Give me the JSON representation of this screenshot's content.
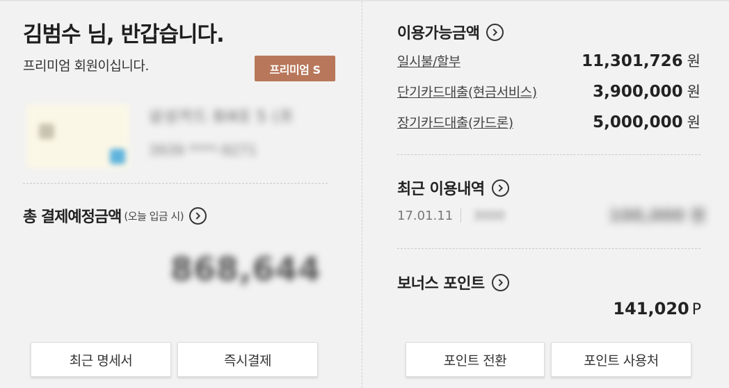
{
  "greeting": "김범수 님, 반갑습니다.",
  "member_text": "프리미엄 회원이십니다.",
  "grade_badge": "프리미엄 S",
  "card": {
    "name_blurred": "삼성카드 BIKE 5 (프",
    "number_blurred": "3939 ****-9271"
  },
  "total_payment": {
    "title": "총 결제예정금액",
    "subtitle": "(오늘 입금 시)",
    "amount_blurred": "868,644"
  },
  "left_buttons": {
    "recent_statement": "최근 명세서",
    "instant_payment": "즉시결제"
  },
  "available_limit": {
    "title": "이용가능금액",
    "rows": [
      {
        "label": "일시불/할부",
        "value": "11,301,726",
        "unit": "원"
      },
      {
        "label": "단기카드대출(현금서비스)",
        "value": "3,900,000",
        "unit": "원"
      },
      {
        "label": "장기카드대출(카드론)",
        "value": "5,000,000",
        "unit": "원"
      }
    ]
  },
  "recent_usage": {
    "title": "최근 이용내역",
    "date": "17.01.11",
    "merchant_blurred": "3000",
    "amount_blurred": "100,000 원"
  },
  "bonus_point": {
    "title": "보너스 포인트",
    "value": "141,020",
    "unit": "P"
  },
  "right_buttons": {
    "point_convert": "포인트 전환",
    "point_usage": "포인트 사용처"
  }
}
